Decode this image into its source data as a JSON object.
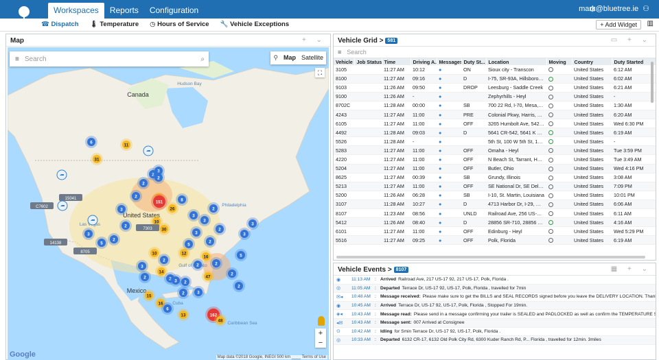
{
  "app": {
    "nav_tabs": [
      "Workspaces",
      "Reports",
      "Configuration"
    ],
    "user": "mark@bluetree.ie"
  },
  "subnav": {
    "items": [
      "Dispatch",
      "Temperature",
      "Hours of Service",
      "Vehicle Exceptions"
    ],
    "add_widget": "+ Add Widget"
  },
  "map_panel": {
    "title": "Map",
    "search_placeholder": "Search",
    "map_types": [
      "Map",
      "Satellite"
    ],
    "copyright": "Map data ©2018 Google, INEGI   500 km ____   Terms of Use",
    "google": "Google",
    "places": [
      "Canada",
      "United States",
      "Mexico",
      "Hudson Bay",
      "Gulf of Mexico",
      "Caribbean Sea",
      "Cuba",
      "Las Vegas",
      "Philadelphia"
    ],
    "truck_labels": [
      "15041",
      "C7602",
      "14138",
      "8705",
      "7303"
    ],
    "clusters": [
      {
        "n": "6",
        "kind": "blue"
      },
      {
        "n": "31",
        "kind": "yellow"
      },
      {
        "n": "11",
        "kind": "yellow"
      },
      {
        "n": "2",
        "kind": "blue"
      },
      {
        "n": "3",
        "kind": "blue"
      },
      {
        "n": "2",
        "kind": "blue"
      },
      {
        "n": "2",
        "kind": "blue"
      },
      {
        "n": "2",
        "kind": "blue"
      },
      {
        "n": "3",
        "kind": "blue"
      },
      {
        "n": "16",
        "kind": "yellow"
      },
      {
        "n": "2",
        "kind": "blue"
      },
      {
        "n": "2",
        "kind": "blue"
      },
      {
        "n": "3",
        "kind": "blue"
      },
      {
        "n": "5",
        "kind": "blue"
      },
      {
        "n": "151",
        "kind": "red"
      },
      {
        "n": "26",
        "kind": "yellow"
      },
      {
        "n": "8",
        "kind": "blue"
      },
      {
        "n": "3",
        "kind": "blue"
      },
      {
        "n": "3",
        "kind": "blue"
      },
      {
        "n": "2",
        "kind": "blue"
      },
      {
        "n": "2",
        "kind": "blue"
      },
      {
        "n": "3",
        "kind": "blue"
      },
      {
        "n": "2",
        "kind": "blue"
      },
      {
        "n": "10",
        "kind": "yellow"
      },
      {
        "n": "30",
        "kind": "yellow"
      },
      {
        "n": "5",
        "kind": "blue"
      },
      {
        "n": "16",
        "kind": "yellow"
      },
      {
        "n": "3",
        "kind": "blue"
      },
      {
        "n": "3",
        "kind": "blue"
      },
      {
        "n": "5",
        "kind": "blue"
      },
      {
        "n": "10",
        "kind": "yellow"
      },
      {
        "n": "12",
        "kind": "yellow"
      },
      {
        "n": "2",
        "kind": "blue"
      },
      {
        "n": "2",
        "kind": "blue"
      },
      {
        "n": "2",
        "kind": "blue"
      },
      {
        "n": "2",
        "kind": "blue"
      },
      {
        "n": "14",
        "kind": "yellow"
      },
      {
        "n": "2",
        "kind": "blue"
      },
      {
        "n": "2",
        "kind": "blue"
      },
      {
        "n": "47",
        "kind": "yellow"
      },
      {
        "n": "3",
        "kind": "blue"
      },
      {
        "n": "2",
        "kind": "blue"
      },
      {
        "n": "15",
        "kind": "yellow"
      },
      {
        "n": "16",
        "kind": "yellow"
      },
      {
        "n": "6",
        "kind": "blue"
      },
      {
        "n": "13",
        "kind": "yellow"
      },
      {
        "n": "27",
        "kind": "yellow"
      },
      {
        "n": "162",
        "kind": "red"
      },
      {
        "n": "48",
        "kind": "yellow"
      },
      {
        "n": "3",
        "kind": "blue"
      },
      {
        "n": "2",
        "kind": "blue"
      },
      {
        "n": "2",
        "kind": "blue"
      },
      {
        "n": "3",
        "kind": "blue"
      }
    ]
  },
  "grid_panel": {
    "title": "Vehicle Grid >",
    "badge": "581",
    "search_placeholder": "Search",
    "columns": [
      "Vehicle",
      "Job Status",
      "Time",
      "Driving A...",
      "Messages",
      "Duty St...",
      "Location",
      "Moving",
      "Country",
      "Duty Started"
    ],
    "rows": [
      [
        "3105",
        "",
        "11:27 AM",
        "10:12",
        "ON",
        "Sioux city - Transcon",
        "off",
        "United States",
        "6:12 AM"
      ],
      [
        "8100",
        "",
        "11:27 AM",
        "09:16",
        "D",
        "I-75, SR-93A, Hillsborough, Fl...",
        "on",
        "United States",
        "6:02 AM"
      ],
      [
        "9103",
        "",
        "11:26 AM",
        "09:50",
        "DROP",
        "Leesburg - Saddle Creek",
        "off",
        "United States",
        "6:21 AM"
      ],
      [
        "9100",
        "",
        "11:26 AM",
        "-",
        "",
        "Zephyrhills - Heyl",
        "off",
        "United States",
        "-"
      ],
      [
        "8702C",
        "",
        "11:28 AM",
        "00:00",
        "SB",
        "700 22 Rd, I-70, Mesa, Grand...",
        "off",
        "United States",
        "1:30 AM"
      ],
      [
        "4243",
        "",
        "11:27 AM",
        "11:00",
        "PRE",
        "Colonial Pkwy, Harris, Texas",
        "off",
        "United States",
        "6:20 AM"
      ],
      [
        "6105",
        "",
        "11:27 AM",
        "11:00",
        "OFF",
        "3265 Humbolt Ave, 5422 Har...",
        "off",
        "United States",
        "Wed 6:30 PM"
      ],
      [
        "4492",
        "",
        "11:28 AM",
        "09:03",
        "D",
        "5641 CR-542, 5641 K Ville Av...",
        "on",
        "United States",
        "6:19 AM"
      ],
      [
        "5526",
        "",
        "11:28 AM",
        "-",
        "",
        "5th St, 100 W 5th St, 101 W 7...",
        "on",
        "United States",
        "-"
      ],
      [
        "5283",
        "",
        "11:27 AM",
        "11:00",
        "OFF",
        "Omaha - Heyl",
        "off",
        "United States",
        "Tue 3:59 PM"
      ],
      [
        "4220",
        "",
        "11:27 AM",
        "11:00",
        "OFF",
        "N Beach St, Tarrant, Haltom ...",
        "off",
        "United States",
        "Tue 3:49 AM"
      ],
      [
        "5204",
        "",
        "11:27 AM",
        "11:00",
        "OFF",
        "Butler, Ohio",
        "off",
        "United States",
        "Wed 4:16 PM"
      ],
      [
        "8625",
        "",
        "11:27 AM",
        "00:39",
        "SB",
        "Grundy, Illinois",
        "off",
        "United States",
        "3:08 AM"
      ],
      [
        "5213",
        "",
        "11:27 AM",
        "11:00",
        "OFF",
        "SE National Dr, SE Delaware ...",
        "off",
        "United States",
        "7:09 PM"
      ],
      [
        "5200",
        "",
        "11:26 AM",
        "06:28",
        "SB",
        "I-10, St. Martin, Louisiana",
        "off",
        "United States",
        "10:01 PM"
      ],
      [
        "3107",
        "",
        "11:28 AM",
        "10:27",
        "D",
        "4713 Harbor Dr, I-29, Wood...",
        "off",
        "United States",
        "6:06 AM"
      ],
      [
        "8107",
        "",
        "11:23 AM",
        "08:56",
        "UNLD",
        "Railroad Ave, 256 US-17 92, ...",
        "off",
        "United States",
        "6:11 AM"
      ],
      [
        "5412",
        "",
        "11:26 AM",
        "08:40",
        "D",
        "28856 SR-710, 28856 SR-710...",
        "on",
        "United States",
        "4:16 AM"
      ],
      [
        "6101",
        "",
        "11:27 AM",
        "11:00",
        "OFF",
        "Edinburg - Heyl",
        "off",
        "United States",
        "Wed 5:29 PM"
      ],
      [
        "5516",
        "",
        "11:27 AM",
        "09:25",
        "OFF",
        "Polk, Florida",
        "off",
        "United States",
        "6:19 AM"
      ]
    ]
  },
  "events_panel": {
    "title": "Vehicle Events >",
    "badge": "8107",
    "events": [
      {
        "icon": "stop-icon",
        "time": "11:13 AM",
        "type": "Arrived",
        "text": "Railroad Ave, 217 US-17 92, 217 US-17, Polk, Florida ."
      },
      {
        "icon": "go-icon",
        "time": "11:05 AM",
        "type": "Departed",
        "text": "Terrace Dr, US-17 92, US-17, Polk, Florida , travelled for 7min"
      },
      {
        "icon": "message-in-icon",
        "time": "10:48 AM",
        "type": "Message received:",
        "text": "Please make sure to get the BILLS and SEAL RECORDS signed before you leave the DELIVERY LOCATION. Thank you."
      },
      {
        "icon": "stop-icon",
        "time": "10:45 AM",
        "type": "Arrived",
        "text": "Terrace Dr, US-17 92, US-17, Polk, Florida , Stopped For 19min."
      },
      {
        "icon": "message-read-icon",
        "time": "10:43 AM",
        "type": "Message read:",
        "text": "Please send in a message confirming your trailer is SEALED and PADLOCKED as well as confirm the TEMPERATURE SETTING (set point o..."
      },
      {
        "icon": "message-sent-icon",
        "time": "10:43 AM",
        "type": "Message sent:",
        "text": "007 Arrived at Consignee"
      },
      {
        "icon": "idle-icon",
        "time": "10:42 AM",
        "type": "Idling",
        "text": "for Smin Terrace Dr, US-17 92, US-17, Polk, Florida ."
      },
      {
        "icon": "go-icon",
        "time": "10:33 AM",
        "type": "Departed",
        "text": "6132 CR-17, 6132 Old Polk City Rd, 6300 Kuder Ranch Rd, P... Florida , travelled for 12min. 3miles"
      }
    ]
  }
}
